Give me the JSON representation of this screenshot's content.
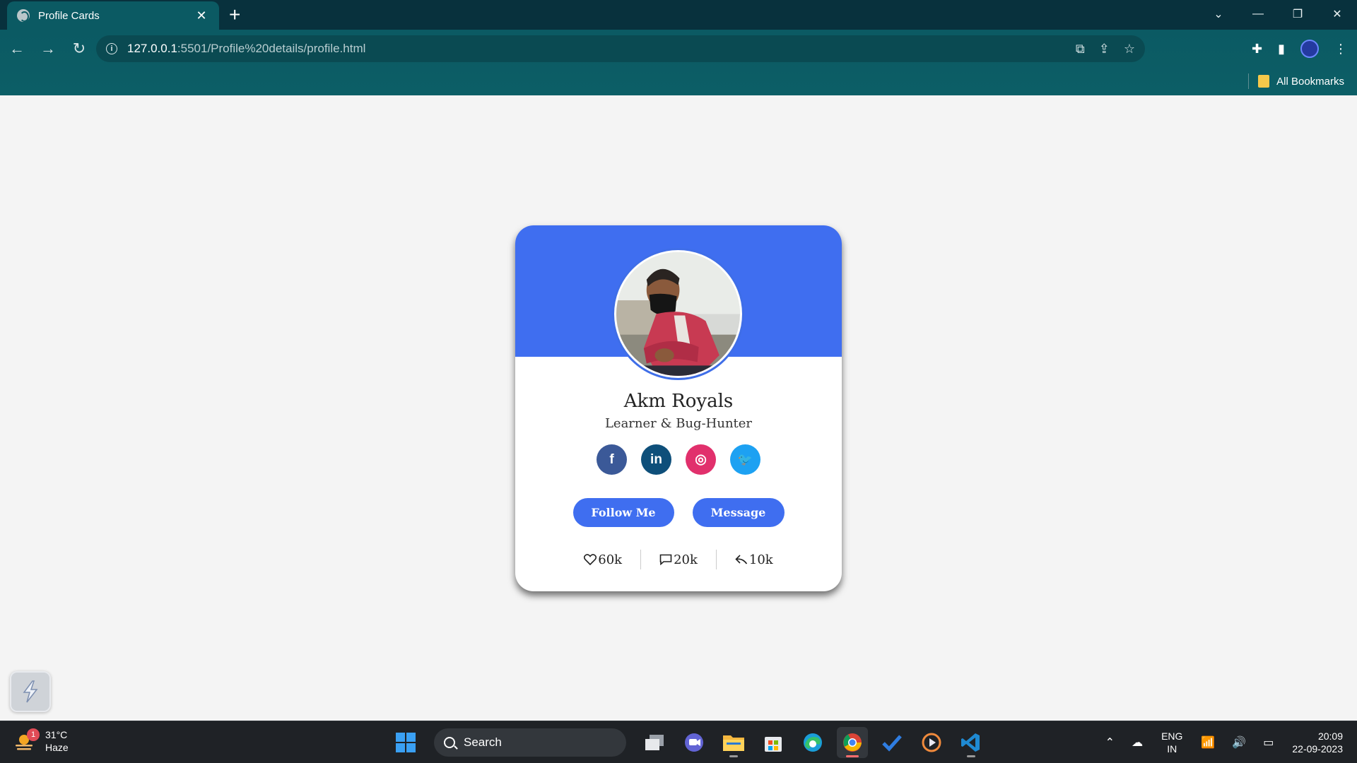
{
  "browser": {
    "tab_title": "Profile Cards",
    "tab_close": "✕",
    "new_tab": "+",
    "url_host": "127.0.0.1",
    "url_path": ":5501/Profile%20details/profile.html",
    "bookmarks_label": "All Bookmarks"
  },
  "card": {
    "accent_color": "#3f6ef0",
    "name": "Akm Royals",
    "role": "Learner & Bug-Hunter",
    "socials": [
      {
        "icon": "facebook-icon",
        "glyph": "f",
        "color": "#3b5998"
      },
      {
        "icon": "linkedin-icon",
        "glyph": "in",
        "color": "#0e4f7a"
      },
      {
        "icon": "instagram-icon",
        "glyph": "◎",
        "color": "#e1306c"
      },
      {
        "icon": "twitter-icon",
        "glyph": "🐦",
        "color": "#1da1f2"
      }
    ],
    "follow_label": "Follow Me",
    "message_label": "Message",
    "stats": {
      "likes": "60k",
      "comments": "20k",
      "shares": "10k"
    }
  },
  "taskbar": {
    "weather_temp": "31°C",
    "weather_desc": "Haze",
    "weather_badge": "1",
    "search_label": "Search",
    "lang_top": "ENG",
    "lang_bottom": "IN",
    "time": "20:09",
    "date": "22-09-2023"
  }
}
